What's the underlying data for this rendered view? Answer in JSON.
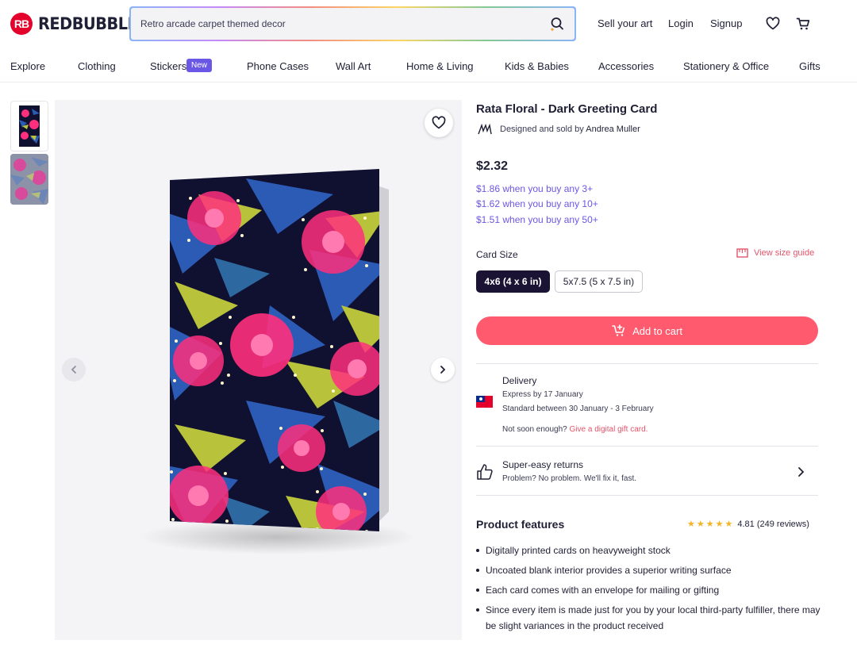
{
  "header": {
    "logo_mark": "RB",
    "logo_text": "REDBUBBLE",
    "search_value": "Retro arcade carpet themed decor",
    "sell_label": "Sell your art",
    "login_label": "Login",
    "signup_label": "Signup",
    "icons": [
      "search-icon",
      "heart-icon",
      "cart-icon"
    ]
  },
  "nav": {
    "items": [
      "Explore",
      "Clothing",
      "Stickers",
      "Phone Cases",
      "Wall Art",
      "Home & Living",
      "Kids & Babies",
      "Accessories",
      "Stationery & Office",
      "Gifts"
    ],
    "new_badge": "New"
  },
  "product": {
    "title": "Rata Floral - Dark Greeting Card",
    "designed_prefix": "Designed and sold by",
    "designer_name": "Andrea Muller",
    "price": "$2.32",
    "tiers": [
      "$1.86 when you buy any 3+",
      "$1.62 when you buy any 10+",
      "$1.51 when you buy any 50+"
    ],
    "size_label": "Card Size",
    "size_guide_label": "View size guide",
    "sizes": [
      "4x6 (4 x 6 in)",
      "5x7.5 (5 x 7.5 in)"
    ],
    "selected_size": "4x6 (4 x 6 in)",
    "add_to_cart": "Add to cart"
  },
  "delivery": {
    "title": "Delivery",
    "express": "Express by 17 January",
    "standard": "Standard between 30 January - 3 February",
    "not_soon": "Not soon enough?",
    "gift_link": "Give a digital gift card."
  },
  "returns": {
    "title": "Super-easy returns",
    "subtitle": "Problem? No problem. We'll fix it, fast."
  },
  "features": {
    "title": "Product features",
    "rating_stars": 5,
    "rating_text": "4.81 (249 reviews)",
    "items": [
      "Digitally printed cards on heavyweight stock",
      "Uncoated blank interior provides a superior writing surface",
      "Each card comes with an envelope for mailing or gifting",
      "Since every item is made just for you by your local third-party fulfiller, there may be slight variances in the product received"
    ]
  },
  "colors": {
    "brand_red": "#e4022d",
    "cart_pink": "#ff5a6e",
    "tier_purple": "#6b57e6",
    "dark_navy": "#1a1333",
    "card_background": "#101030",
    "card_magenta": "#ff2f7d",
    "card_blue": "#2c5bb5",
    "card_olive": "#b8c23a"
  }
}
